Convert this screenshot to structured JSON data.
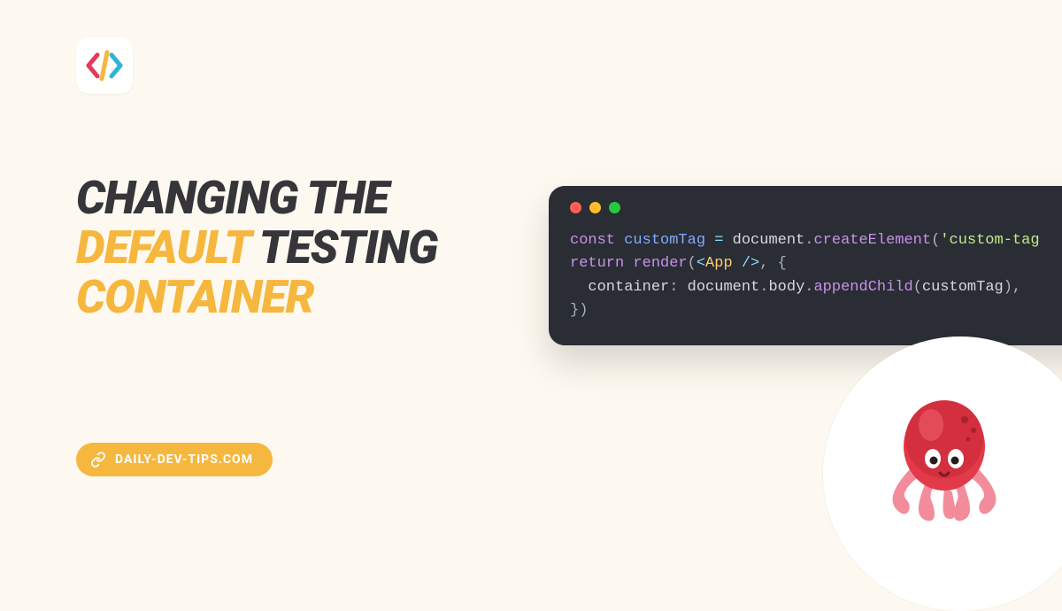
{
  "logo": {
    "name": "code-brackets-logo"
  },
  "headline": {
    "w1": "Changing",
    "w2": "the",
    "w3": "default",
    "w4": "testing",
    "w5": "container"
  },
  "site": {
    "label": "DAILY-DEV-TIPS.COM"
  },
  "code": {
    "l1_kw": "const",
    "l1_var": " customTag ",
    "l1_eq": "= ",
    "l1_obj": "document",
    "l1_dot1": ".",
    "l1_fn": "createElement",
    "l1_open": "(",
    "l1_str": "'custom-tag",
    "l2_blank": "",
    "l3_kw": "return",
    "l3_sp": " ",
    "l3_fn": "render",
    "l3_open": "(",
    "l3_jsx_open": "<",
    "l3_jsx_name": "App ",
    "l3_jsx_close": "/>",
    "l3_comma": ", {",
    "l4_indent": "  ",
    "l4_key": "container",
    "l4_colon": ": ",
    "l4_doc": "document",
    "l4_d1": ".",
    "l4_body": "body",
    "l4_d2": ".",
    "l4_fn": "appendChild",
    "l4_open": "(",
    "l4_arg": "customTag",
    "l4_close": "),",
    "l5": "})"
  },
  "mascot": {
    "name": "octopus-mascot"
  }
}
